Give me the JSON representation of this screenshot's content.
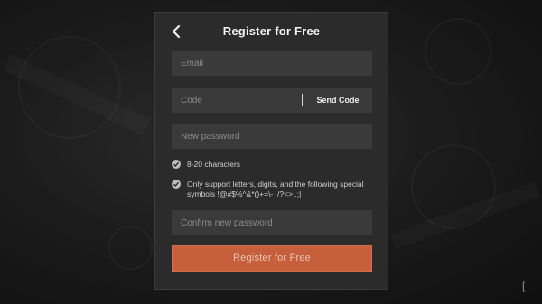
{
  "dialog": {
    "title": "Register for Free",
    "email_placeholder": "Email",
    "code_placeholder": "Code",
    "send_code_label": "Send Code",
    "new_password_placeholder": "New password",
    "rules": [
      {
        "text": "8-20 characters"
      },
      {
        "text": "Only support letters, digits, and the following special symbols !@#$%^&*()+=\\-_/?<>,.;|"
      }
    ],
    "confirm_password_placeholder": "Confirm new password",
    "register_label": "Register for Free"
  },
  "icons": {
    "back": "chevron-left-icon",
    "check": "check-circle-icon"
  },
  "colors": {
    "dialog_bg": "#2b2b2b",
    "field_bg": "#3a3a3a",
    "accent": "#c55f3c"
  },
  "background": {
    "bracket_glyph": "["
  }
}
